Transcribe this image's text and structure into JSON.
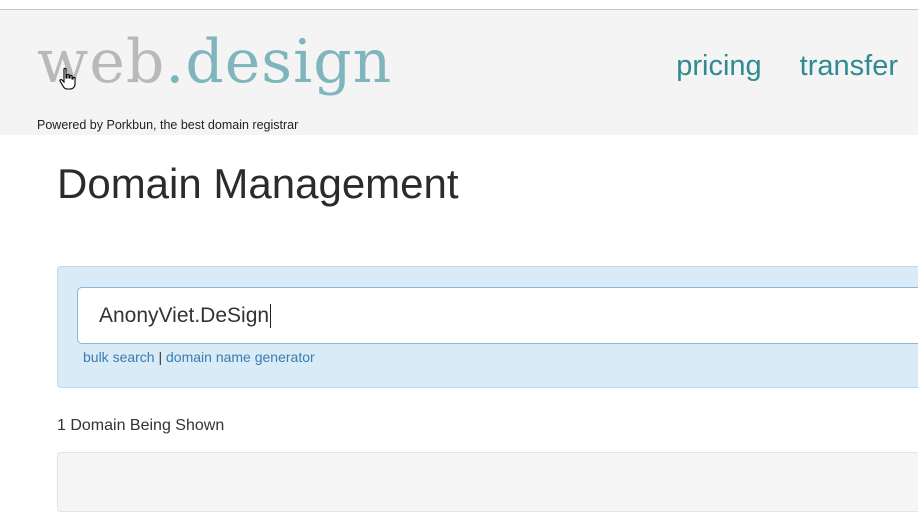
{
  "header": {
    "logo": {
      "web": "web",
      "dot": ".",
      "design": "design"
    },
    "tagline": "Powered by Porkbun, the best domain registrar",
    "nav": [
      {
        "label": "pricing"
      },
      {
        "label": "transfer"
      }
    ],
    "cursor_icon": "hand-pointer-icon"
  },
  "main": {
    "title": "Domain Management",
    "search": {
      "value": "AnonyViet.DeSign",
      "links": {
        "bulk_search": "bulk search",
        "separator": "|",
        "generator": "domain name generator"
      }
    },
    "count_text": "1 Domain Being Shown"
  },
  "colors": {
    "accent": "#2f8a91",
    "logo_light": "#7fb6bd",
    "panel_bg": "#d9ebf7",
    "link": "#3a7cb3"
  }
}
